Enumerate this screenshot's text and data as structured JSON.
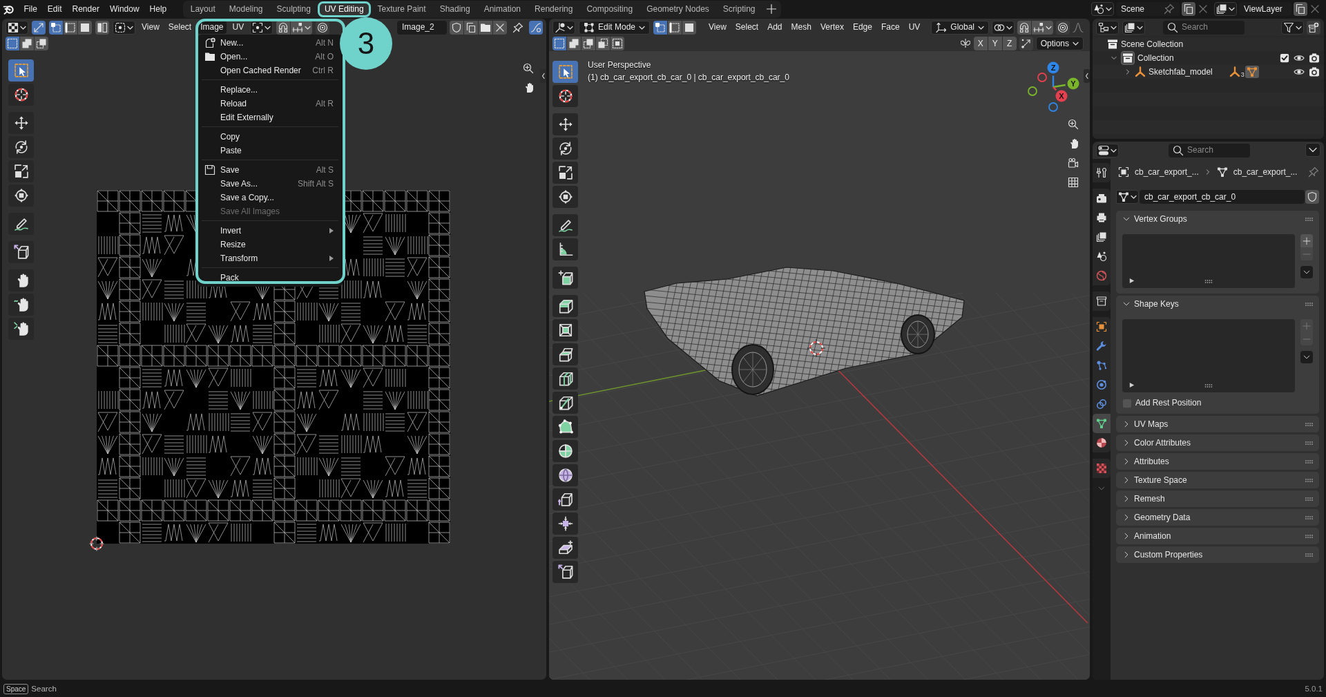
{
  "top_bar": {
    "menus": [
      "File",
      "Edit",
      "Render",
      "Window",
      "Help"
    ],
    "workspaces": [
      {
        "label": "Layout",
        "selected": false,
        "outlined": false
      },
      {
        "label": "Modeling",
        "selected": false,
        "outlined": false
      },
      {
        "label": "Sculpting",
        "selected": false,
        "outlined": false
      },
      {
        "label": "UV Editing",
        "selected": true,
        "outlined": true
      },
      {
        "label": "Texture Paint",
        "selected": false,
        "outlined": false
      },
      {
        "label": "Shading",
        "selected": false,
        "outlined": false
      },
      {
        "label": "Animation",
        "selected": false,
        "outlined": false
      },
      {
        "label": "Rendering",
        "selected": false,
        "outlined": false
      },
      {
        "label": "Compositing",
        "selected": false,
        "outlined": false
      },
      {
        "label": "Geometry Nodes",
        "selected": false,
        "outlined": false
      },
      {
        "label": "Scripting",
        "selected": false,
        "outlined": false
      }
    ],
    "scene": "Scene",
    "view_layer": "ViewLayer"
  },
  "callout": {
    "label": "3"
  },
  "uv_editor": {
    "sync_selection": true,
    "select_modes": [
      {
        "kind": "vertex",
        "selected": true
      },
      {
        "kind": "edge",
        "selected": false
      },
      {
        "kind": "face",
        "selected": false
      }
    ],
    "menus": [
      {
        "label": "View",
        "selected": false
      },
      {
        "label": "Select",
        "selected": false
      },
      {
        "label": "Image",
        "selected": true
      },
      {
        "label": "UV",
        "selected": false
      }
    ],
    "image_name": "Image_2",
    "stroke_toggle": {
      "on": true
    },
    "box_modes": [
      {
        "kind": "new",
        "selected": true
      },
      {
        "kind": "extend",
        "selected": false
      },
      {
        "kind": "subtract",
        "selected": false
      }
    ],
    "tool_groups": [
      [
        {
          "kind": "select",
          "selected": true
        },
        {
          "kind": "cursor",
          "selected": false
        }
      ],
      [
        {
          "kind": "move",
          "selected": false
        },
        {
          "kind": "rotate",
          "selected": false
        },
        {
          "kind": "scale",
          "selected": false
        },
        {
          "kind": "transform",
          "selected": false
        }
      ],
      [
        {
          "kind": "annotate",
          "selected": false
        }
      ],
      [
        {
          "kind": "rip",
          "selected": false
        }
      ],
      [
        {
          "kind": "grab",
          "selected": false
        },
        {
          "kind": "relax",
          "selected": false
        },
        {
          "kind": "pinch",
          "selected": false
        }
      ]
    ],
    "image_menu": {
      "outlined": true,
      "groups": [
        [
          {
            "kind": "new",
            "label": "New...",
            "shortcut": "Alt N",
            "disabled": false,
            "submenu": false
          },
          {
            "kind": "open",
            "label": "Open...",
            "shortcut": "Alt O",
            "disabled": false,
            "submenu": false
          },
          {
            "kind": "plain",
            "label": "Open Cached Render",
            "shortcut": "Ctrl R",
            "disabled": false,
            "submenu": false
          }
        ],
        [
          {
            "kind": "plain",
            "label": "Replace...",
            "disabled": false,
            "submenu": false
          },
          {
            "kind": "plain",
            "label": "Reload",
            "shortcut": "Alt R",
            "disabled": false,
            "submenu": false
          },
          {
            "kind": "plain",
            "label": "Edit Externally",
            "disabled": false,
            "submenu": false
          }
        ],
        [
          {
            "kind": "plain",
            "label": "Copy",
            "disabled": false,
            "submenu": false
          },
          {
            "kind": "plain",
            "label": "Paste",
            "disabled": false,
            "submenu": false
          }
        ],
        [
          {
            "kind": "save",
            "label": "Save",
            "shortcut": "Alt S",
            "disabled": false,
            "submenu": false
          },
          {
            "kind": "plain",
            "label": "Save As...",
            "shortcut": "Shift Alt S",
            "disabled": false,
            "submenu": false
          },
          {
            "kind": "plain",
            "label": "Save a Copy...",
            "disabled": false,
            "submenu": false
          },
          {
            "kind": "plain",
            "label": "Save All Images",
            "disabled": true,
            "submenu": false
          }
        ],
        [
          {
            "kind": "plain",
            "label": "Invert",
            "disabled": false,
            "submenu": true
          },
          {
            "kind": "plain",
            "label": "Resize",
            "disabled": false,
            "submenu": false
          },
          {
            "kind": "plain",
            "label": "Transform",
            "disabled": false,
            "submenu": true
          }
        ],
        [
          {
            "kind": "plain",
            "label": "Pack",
            "disabled": false,
            "submenu": false
          }
        ]
      ]
    }
  },
  "viewport": {
    "mode": "Edit Mode",
    "select_modes": [
      {
        "kind": "vertex",
        "selected": true
      },
      {
        "kind": "edge",
        "selected": false
      },
      {
        "kind": "face",
        "selected": false
      }
    ],
    "menus": [
      "View",
      "Select",
      "Add",
      "Mesh",
      "Vertex",
      "Edge",
      "Face",
      "UV"
    ],
    "orientation": "Global",
    "box_modes": [
      {
        "kind": "new",
        "selected": true
      },
      {
        "kind": "extend",
        "selected": false
      },
      {
        "kind": "subtract",
        "selected": false
      },
      {
        "kind": "invert",
        "selected": false
      },
      {
        "kind": "intersect",
        "selected": false
      }
    ],
    "mirror_axes": [
      {
        "label": "X",
        "on": false
      },
      {
        "label": "Y",
        "on": false
      },
      {
        "label": "Z",
        "on": false
      }
    ],
    "options": "Options",
    "view_name": "User Perspective",
    "object_info": "(1) cb_car_export_cb_car_0 | cb_car_export_cb_car_0",
    "gizmo_axes": [
      {
        "label": "Z",
        "color": "#2e86e8"
      },
      {
        "label": "Y",
        "color": "#7ab52a"
      },
      {
        "label": "X",
        "color": "#e5404f"
      }
    ],
    "tool_groups": [
      [
        {
          "kind": "select",
          "selected": true
        },
        {
          "kind": "cursor",
          "selected": false
        }
      ],
      [
        {
          "kind": "move",
          "selected": false
        },
        {
          "kind": "rotate",
          "selected": false
        },
        {
          "kind": "scale",
          "selected": false
        },
        {
          "kind": "transform",
          "selected": false
        }
      ],
      [
        {
          "kind": "annotate",
          "selected": false
        },
        {
          "kind": "measure",
          "selected": false
        }
      ],
      [
        {
          "kind": "add_cube",
          "selected": false
        }
      ],
      [
        {
          "kind": "extrude",
          "selected": false
        },
        {
          "kind": "inset",
          "selected": false
        },
        {
          "kind": "bevel",
          "selected": false
        },
        {
          "kind": "loop_cut",
          "selected": false
        },
        {
          "kind": "knife",
          "selected": false
        },
        {
          "kind": "poly_build",
          "selected": false
        },
        {
          "kind": "spin",
          "selected": false
        },
        {
          "kind": "smooth",
          "selected": false
        },
        {
          "kind": "edge_slide",
          "selected": false
        },
        {
          "kind": "shrink",
          "selected": false
        },
        {
          "kind": "shear",
          "selected": false
        },
        {
          "kind": "rip",
          "selected": false
        }
      ]
    ]
  },
  "outliner": {
    "search_placeholder": "Search",
    "tree": [
      {
        "kind": "scene_collection",
        "label": "Scene Collection",
        "children": [
          {
            "kind": "collection",
            "label": "Collection",
            "active": true,
            "expanded": true,
            "checked": true,
            "children": [
              {
                "kind": "empty",
                "label": "Sketchfab_model",
                "expanded": false,
                "child_count": "3"
              }
            ]
          }
        ]
      }
    ]
  },
  "properties": {
    "search_placeholder": "Search",
    "tab_groups": [
      [
        {
          "kind": "tool",
          "selected": false
        }
      ],
      [
        {
          "kind": "render",
          "selected": false
        },
        {
          "kind": "output",
          "selected": false
        },
        {
          "kind": "view_layer",
          "selected": false
        },
        {
          "kind": "scene",
          "selected": false
        },
        {
          "kind": "world",
          "selected": false
        }
      ],
      [
        {
          "kind": "collection",
          "selected": false
        }
      ],
      [
        {
          "kind": "object",
          "selected": false
        },
        {
          "kind": "modifiers",
          "selected": false
        },
        {
          "kind": "particles",
          "selected": false
        },
        {
          "kind": "physics",
          "selected": false
        },
        {
          "kind": "constraints",
          "selected": false
        },
        {
          "kind": "data",
          "selected": true
        },
        {
          "kind": "material",
          "selected": false
        }
      ],
      [
        {
          "kind": "texture",
          "selected": false
        }
      ]
    ],
    "breadcrumb": [
      {
        "kind": "object",
        "label": "cb_car_export_..."
      },
      {
        "kind": "mesh",
        "label": "cb_car_export_..."
      }
    ],
    "data_name": "cb_car_export_cb_car_0",
    "panels": [
      {
        "title": "Vertex Groups",
        "expanded": true,
        "list_buttons": [
          {
            "kind": "add",
            "disabled": false
          },
          {
            "kind": "remove",
            "disabled": true
          }
        ]
      },
      {
        "title": "Shape Keys",
        "expanded": true,
        "list_buttons": [
          {
            "kind": "add",
            "disabled": true
          },
          {
            "kind": "remove",
            "disabled": true
          }
        ],
        "option": {
          "label": "Add Rest Position",
          "checked": false
        }
      },
      {
        "title": "UV Maps",
        "expanded": false
      },
      {
        "title": "Color Attributes",
        "expanded": false
      },
      {
        "title": "Attributes",
        "expanded": false
      },
      {
        "title": "Texture Space",
        "expanded": false
      },
      {
        "title": "Remesh",
        "expanded": false
      },
      {
        "title": "Geometry Data",
        "expanded": false
      },
      {
        "title": "Animation",
        "expanded": false
      },
      {
        "title": "Custom Properties",
        "expanded": false
      }
    ]
  },
  "status_bar": {
    "key": "Space",
    "hint": "Search",
    "version": "5.0.1"
  }
}
